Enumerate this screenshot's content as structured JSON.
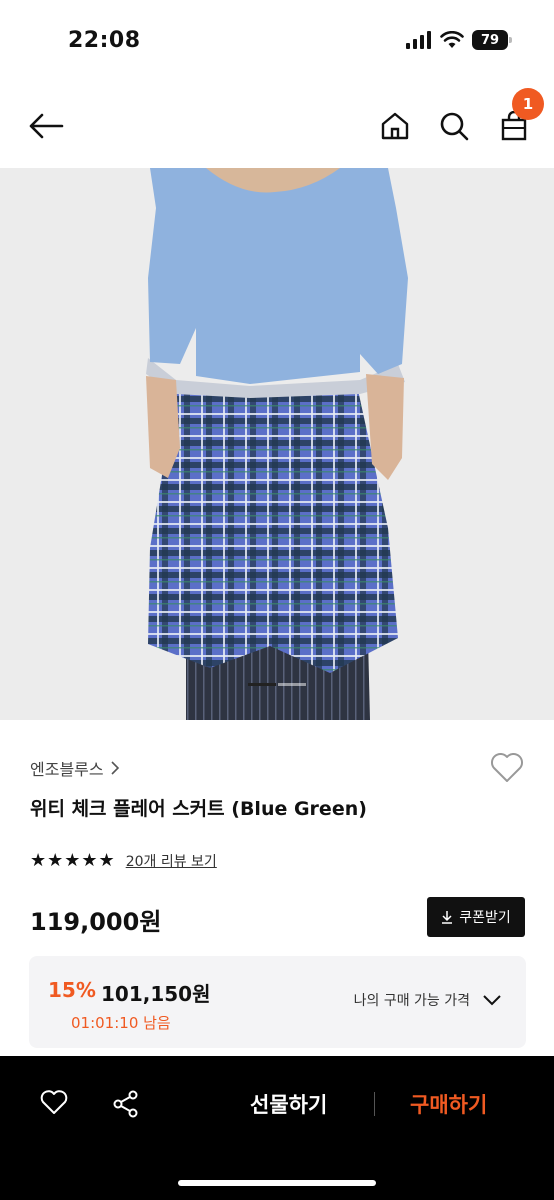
{
  "status": {
    "time": "22:08",
    "battery": "79"
  },
  "nav": {
    "cart_count": "1"
  },
  "product": {
    "brand": "엔조블루스",
    "title": "위티 체크 플레어 스커트 (Blue Green)",
    "stars": "★★★★★",
    "review_link": "20개 리뷰 보기",
    "price": "119,000원",
    "coupon_label": "쿠폰받기"
  },
  "discount": {
    "percent": "15%",
    "price": "101,150원",
    "timer": "01:01:10 남음",
    "link_label": "나의 구매 가능 가격"
  },
  "bottom": {
    "gift_label": "선물하기",
    "buy_label": "구매하기"
  },
  "colors": {
    "accent": "#f05a22",
    "dark": "#111111"
  },
  "icons": {
    "back": "arrow-left-icon",
    "home": "home-icon",
    "search": "search-icon",
    "cart": "shopping-bag-icon",
    "wish": "heart-icon",
    "share": "share-icon",
    "download": "download-icon"
  }
}
